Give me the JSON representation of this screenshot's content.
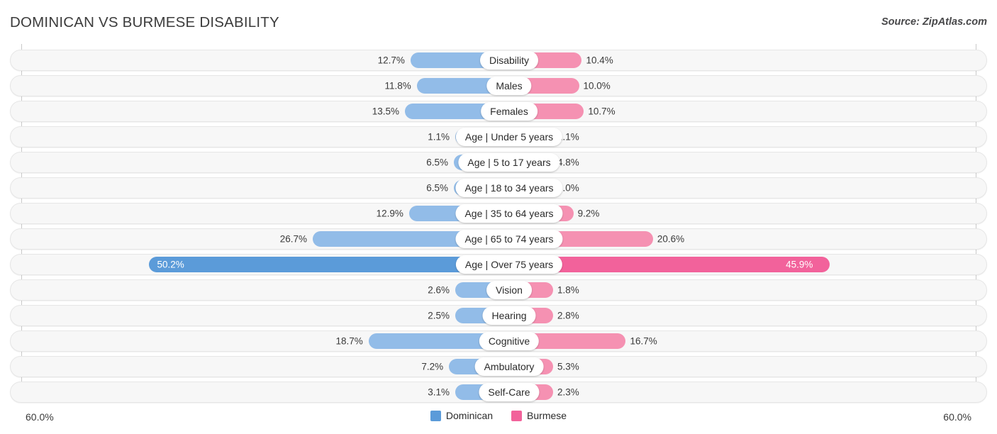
{
  "header": {
    "title": "DOMINICAN VS BURMESE DISABILITY",
    "source": "Source: ZipAtlas.com"
  },
  "axis": {
    "left_label": "60.0%",
    "right_label": "60.0%",
    "max": 60.0
  },
  "legend": {
    "items": [
      {
        "label": "Dominican",
        "color": "#5b9bd9"
      },
      {
        "label": "Burmese",
        "color": "#f2629b"
      }
    ]
  },
  "colors": {
    "left_bar": "#92bce8",
    "right_bar": "#f591b2",
    "left_bar_highlight": "#5b9bd9",
    "right_bar_highlight": "#f2629b",
    "row_track": "#f7f7f7",
    "gridline": "#c9c9c9"
  },
  "chart_data": {
    "type": "bar",
    "orientation": "horizontal-diverging",
    "title": "DOMINICAN VS BURMESE DISABILITY",
    "subtitle": "Source: ZipAtlas.com",
    "xlabel": "",
    "ylabel": "",
    "xlim": [
      -60.0,
      60.0
    ],
    "axis_tick_labels": [
      "60.0%",
      "60.0%"
    ],
    "grid": true,
    "legend_position": "bottom-center",
    "units": "percent",
    "categories": [
      "Disability",
      "Males",
      "Females",
      "Age | Under 5 years",
      "Age | 5 to 17 years",
      "Age | 18 to 34 years",
      "Age | 35 to 64 years",
      "Age | 65 to 74 years",
      "Age | Over 75 years",
      "Vision",
      "Hearing",
      "Cognitive",
      "Ambulatory",
      "Self-Care"
    ],
    "series": [
      {
        "name": "Dominican",
        "side": "left",
        "color": "#92bce8",
        "values": [
          12.7,
          11.8,
          13.5,
          1.1,
          6.5,
          6.5,
          12.9,
          26.7,
          50.2,
          2.6,
          2.5,
          18.7,
          7.2,
          3.1
        ]
      },
      {
        "name": "Burmese",
        "side": "right",
        "color": "#f591b2",
        "values": [
          10.4,
          10.0,
          10.7,
          1.1,
          4.8,
          6.0,
          9.2,
          20.6,
          45.9,
          1.8,
          2.8,
          16.7,
          5.3,
          2.3
        ]
      }
    ],
    "rows": [
      {
        "label": "Disability",
        "left_value": 12.7,
        "right_value": 10.4,
        "left_text": "12.7%",
        "right_text": "10.4%",
        "highlight": false
      },
      {
        "label": "Males",
        "left_value": 11.8,
        "right_value": 10.0,
        "left_text": "11.8%",
        "right_text": "10.0%",
        "highlight": false
      },
      {
        "label": "Females",
        "left_value": 13.5,
        "right_value": 10.7,
        "left_text": "13.5%",
        "right_text": "10.7%",
        "highlight": false
      },
      {
        "label": "Age | Under 5 years",
        "left_value": 1.1,
        "right_value": 1.1,
        "left_text": "1.1%",
        "right_text": "1.1%",
        "highlight": false
      },
      {
        "label": "Age | 5 to 17 years",
        "left_value": 6.5,
        "right_value": 4.8,
        "left_text": "6.5%",
        "right_text": "4.8%",
        "highlight": false
      },
      {
        "label": "Age | 18 to 34 years",
        "left_value": 6.5,
        "right_value": 6.0,
        "left_text": "6.5%",
        "right_text": "6.0%",
        "highlight": false
      },
      {
        "label": "Age | 35 to 64 years",
        "left_value": 12.9,
        "right_value": 9.2,
        "left_text": "12.9%",
        "right_text": "9.2%",
        "highlight": false
      },
      {
        "label": "Age | 65 to 74 years",
        "left_value": 26.7,
        "right_value": 20.6,
        "left_text": "26.7%",
        "right_text": "20.6%",
        "highlight": false
      },
      {
        "label": "Age | Over 75 years",
        "left_value": 50.2,
        "right_value": 45.9,
        "left_text": "50.2%",
        "right_text": "45.9%",
        "highlight": true
      },
      {
        "label": "Vision",
        "left_value": 2.6,
        "right_value": 1.8,
        "left_text": "2.6%",
        "right_text": "1.8%",
        "highlight": false
      },
      {
        "label": "Hearing",
        "left_value": 2.5,
        "right_value": 2.8,
        "left_text": "2.5%",
        "right_text": "2.8%",
        "highlight": false
      },
      {
        "label": "Cognitive",
        "left_value": 18.7,
        "right_value": 16.7,
        "left_text": "18.7%",
        "right_text": "16.7%",
        "highlight": false
      },
      {
        "label": "Ambulatory",
        "left_value": 7.2,
        "right_value": 5.3,
        "left_text": "7.2%",
        "right_text": "5.3%",
        "highlight": false
      },
      {
        "label": "Self-Care",
        "left_value": 3.1,
        "right_value": 2.3,
        "left_text": "3.1%",
        "right_text": "2.3%",
        "highlight": false
      }
    ]
  }
}
